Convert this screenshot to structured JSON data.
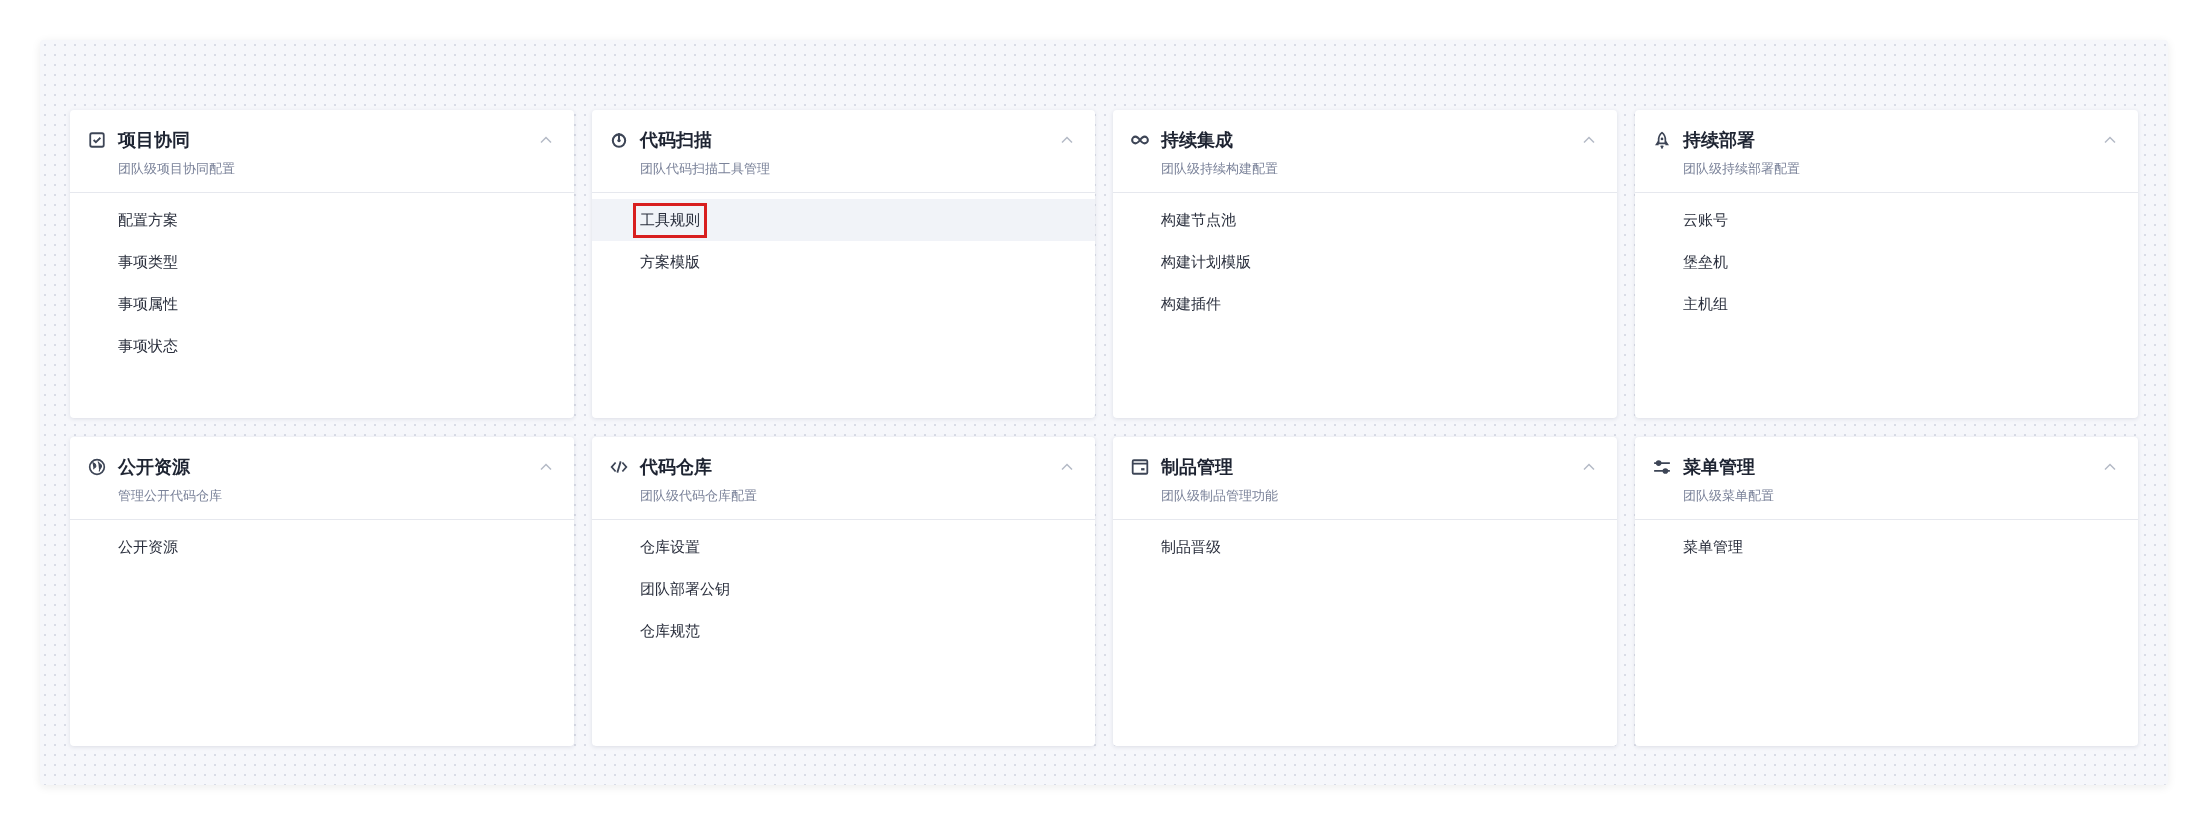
{
  "cards": [
    {
      "title": "项目协同",
      "subtitle": "团队级项目协同配置",
      "expanded": true,
      "items": [
        {
          "label": "配置方案",
          "selected": false,
          "annotated": false
        },
        {
          "label": "事项类型",
          "selected": false,
          "annotated": false
        },
        {
          "label": "事项属性",
          "selected": false,
          "annotated": false
        },
        {
          "label": "事项状态",
          "selected": false,
          "annotated": false
        }
      ]
    },
    {
      "title": "代码扫描",
      "subtitle": "团队代码扫描工具管理",
      "expanded": true,
      "items": [
        {
          "label": "工具规则",
          "selected": true,
          "annotated": true
        },
        {
          "label": "方案模版",
          "selected": false,
          "annotated": false
        }
      ]
    },
    {
      "title": "持续集成",
      "subtitle": "团队级持续构建配置",
      "expanded": true,
      "items": [
        {
          "label": "构建节点池",
          "selected": false,
          "annotated": false
        },
        {
          "label": "构建计划模版",
          "selected": false,
          "annotated": false
        },
        {
          "label": "构建插件",
          "selected": false,
          "annotated": false
        }
      ]
    },
    {
      "title": "持续部署",
      "subtitle": "团队级持续部署配置",
      "expanded": true,
      "items": [
        {
          "label": "云账号",
          "selected": false,
          "annotated": false
        },
        {
          "label": "堡垒机",
          "selected": false,
          "annotated": false
        },
        {
          "label": "主机组",
          "selected": false,
          "annotated": false
        }
      ]
    },
    {
      "title": "公开资源",
      "subtitle": "管理公开代码仓库",
      "expanded": true,
      "items": [
        {
          "label": "公开资源",
          "selected": false,
          "annotated": false
        }
      ]
    },
    {
      "title": "代码仓库",
      "subtitle": "团队级代码仓库配置",
      "expanded": true,
      "items": [
        {
          "label": "仓库设置",
          "selected": false,
          "annotated": false
        },
        {
          "label": "团队部署公钥",
          "selected": false,
          "annotated": false
        },
        {
          "label": "仓库规范",
          "selected": false,
          "annotated": false
        }
      ]
    },
    {
      "title": "制品管理",
      "subtitle": "团队级制品管理功能",
      "expanded": true,
      "items": [
        {
          "label": "制品晋级",
          "selected": false,
          "annotated": false
        }
      ]
    },
    {
      "title": "菜单管理",
      "subtitle": "团队级菜单配置",
      "expanded": true,
      "items": [
        {
          "label": "菜单管理",
          "selected": false,
          "annotated": false
        }
      ]
    }
  ]
}
